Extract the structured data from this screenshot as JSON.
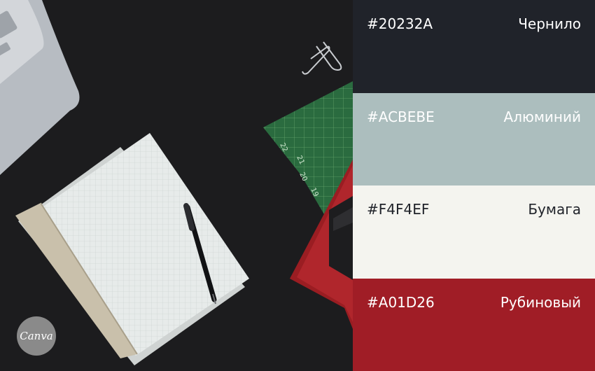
{
  "palette": [
    {
      "hex": "#20232A",
      "name": "Чернило",
      "bg": "#20232A",
      "fg": "#FFFFFF"
    },
    {
      "hex": "#ACBEBE",
      "name": "Алюминий",
      "bg": "#ACBEBE",
      "fg": "#FFFFFF"
    },
    {
      "hex": "#F4F4EF",
      "name": "Бумага",
      "bg": "#F4F4EF",
      "fg": "#20232A"
    },
    {
      "hex": "#A01D26",
      "name": "Рубиновый",
      "bg": "#A01D26",
      "fg": "#FFFFFF"
    }
  ],
  "cutting_mat_numbers": [
    "22",
    "21",
    "20",
    "19"
  ],
  "logo": "Canva"
}
